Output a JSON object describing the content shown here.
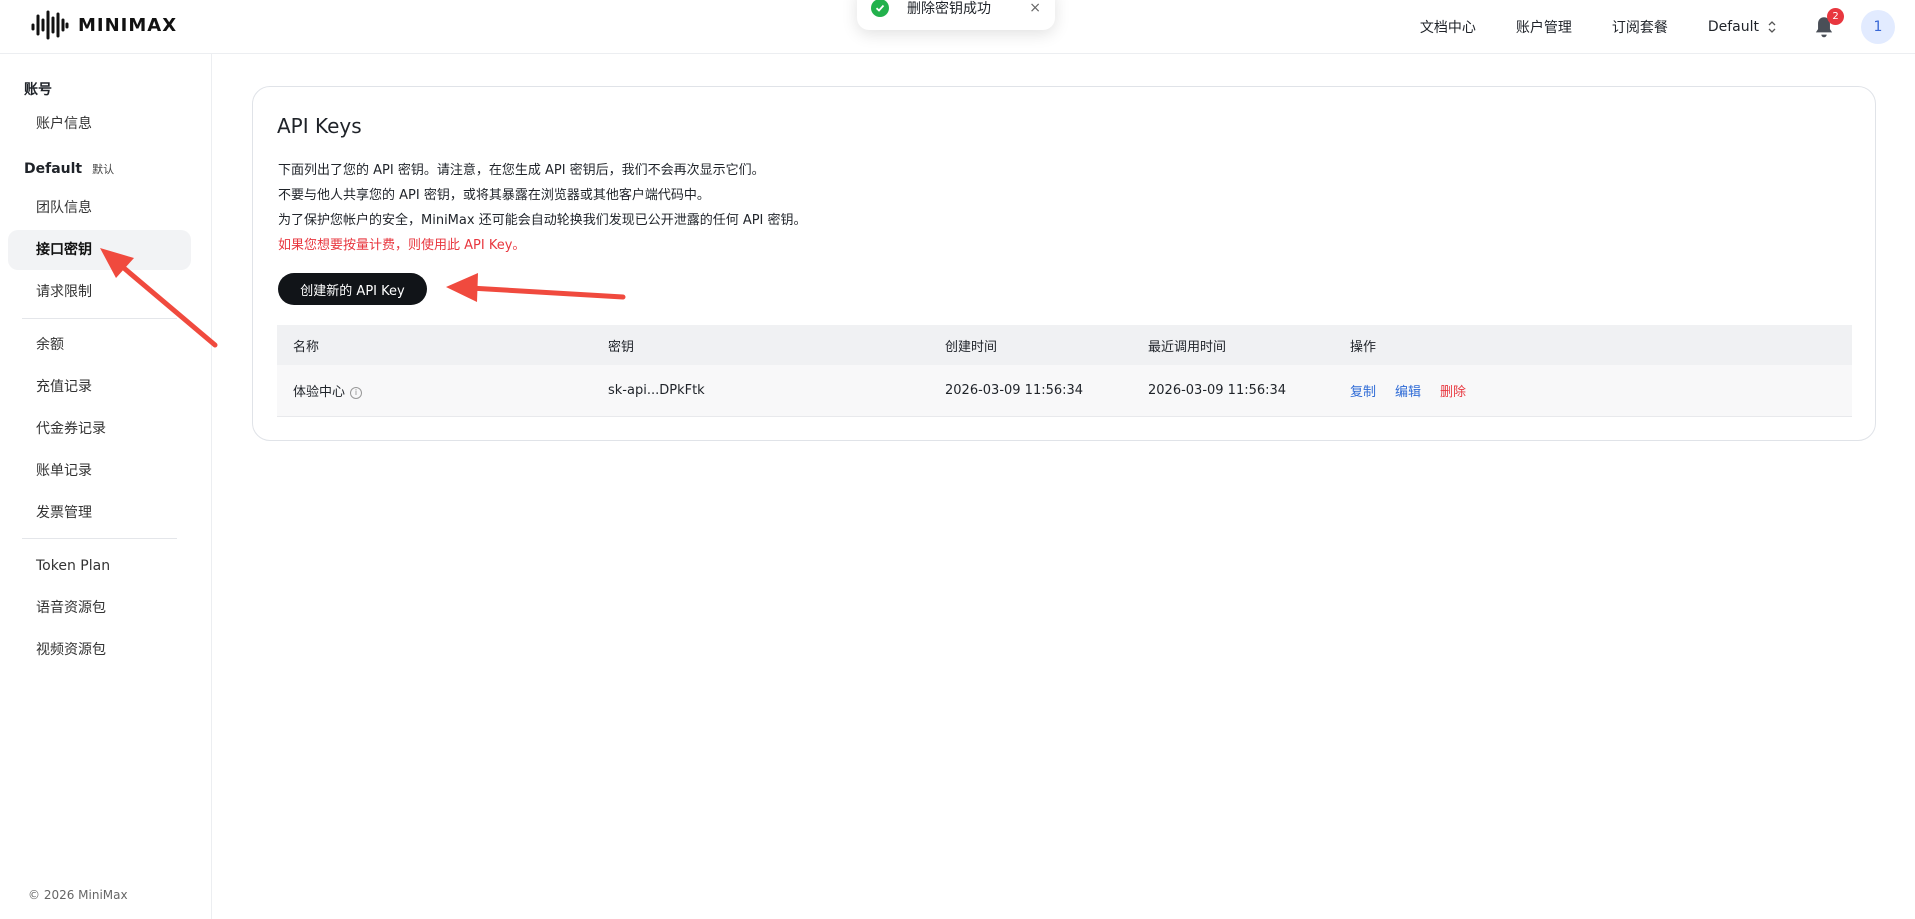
{
  "header": {
    "logo_text": "MINIMAX",
    "nav": [
      "文档中心",
      "账户管理",
      "订阅套餐"
    ],
    "org": "Default",
    "notifications": "2",
    "avatar": "1"
  },
  "toast": {
    "text": "删除密钥成功",
    "close": "×"
  },
  "sidebar": {
    "account_heading": "账号",
    "account_info": "账户信息",
    "org_heading": "Default",
    "org_tag": "默认",
    "items_group1": [
      "团队信息",
      "接口密钥",
      "请求限制"
    ],
    "items_group2": [
      "余额",
      "充值记录",
      "代金券记录",
      "账单记录",
      "发票管理"
    ],
    "items_group3": [
      "Token Plan",
      "语音资源包",
      "视频资源包"
    ],
    "copyright": "© 2026 MiniMax"
  },
  "main": {
    "title": "API Keys",
    "desc": [
      "下面列出了您的 API 密钥。请注意，在您生成 API 密钥后，我们不会再次显示它们。",
      "不要与他人共享您的 API 密钥，或将其暴露在浏览器或其他客户端代码中。",
      "为了保护您帐户的安全，MiniMax 还可能会自动轮换我们发现已公开泄露的任何 API 密钥。"
    ],
    "desc_red": "如果您想要按量计费，则使用此 API Key。",
    "create_button": "创建新的 API Key",
    "table": {
      "headers": [
        "名称",
        "密钥",
        "创建时间",
        "最近调用时间",
        "操作"
      ],
      "rows": [
        {
          "name": "体验中心",
          "key": "sk-api...DPkFtk",
          "created": "2026-03-09 11:56:34",
          "last_used": "2026-03-09 11:56:34",
          "actions": [
            "复制",
            "编辑",
            "删除"
          ]
        }
      ]
    }
  },
  "colors": {
    "accent_red": "#e8373f",
    "link_blue": "#2f6bd6",
    "button_dark": "#111418",
    "success_green": "#22b14c"
  }
}
